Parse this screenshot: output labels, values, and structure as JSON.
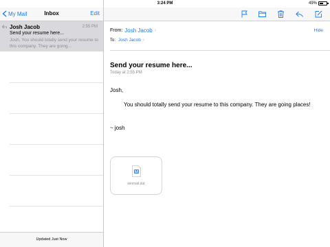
{
  "status_bar": {
    "device": "iPad",
    "time": "3:24 PM",
    "battery": "49%",
    "battery_level": 0.49
  },
  "sidebar": {
    "back_label": "My Mail",
    "title": "Inbox",
    "edit_label": "Edit",
    "messages": [
      {
        "sender": "Josh Jacob",
        "time": "2:55 PM",
        "subject": "Send your resume here...",
        "preview": "Josh, You should totally send your resume to this company. They are going..."
      }
    ],
    "footer": "Updated Just Now"
  },
  "toolbar": {
    "icons": [
      "flag-icon",
      "folder-icon",
      "trash-icon",
      "reply-icon",
      "compose-icon"
    ],
    "accent": "#1a7cf2"
  },
  "message": {
    "from_label": "From:",
    "from_name": "Josh Jacob",
    "to_label": "To:",
    "to_name": "Josh Jacob",
    "hide_label": "Hide",
    "subject": "Send your resume here...",
    "date": "Today at 2:55 PM",
    "greeting": "Josh,",
    "paragraph": "You should totally send your resume to this company. They are going places!",
    "signature": "~ josh",
    "attachment": "winmail.dat"
  }
}
